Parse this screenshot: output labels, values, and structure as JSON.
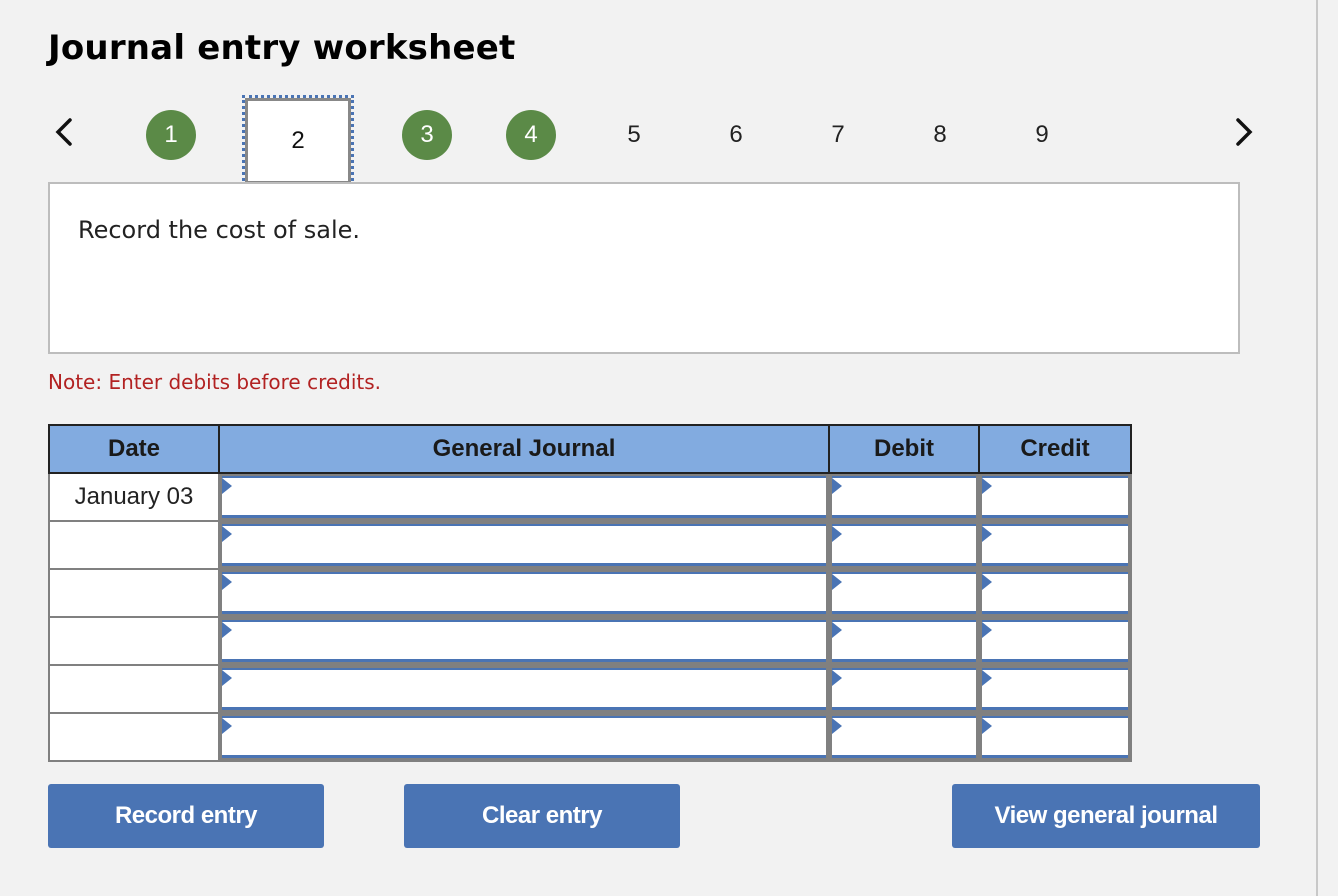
{
  "title": "Journal entry worksheet",
  "nav": {
    "prev_icon": "chevron-left-icon",
    "next_icon": "chevron-right-icon",
    "steps": [
      {
        "label": "1",
        "state": "done"
      },
      {
        "label": "2",
        "state": "current"
      },
      {
        "label": "3",
        "state": "done"
      },
      {
        "label": "4",
        "state": "done"
      },
      {
        "label": "5",
        "state": "plain"
      },
      {
        "label": "6",
        "state": "plain"
      },
      {
        "label": "7",
        "state": "plain"
      },
      {
        "label": "8",
        "state": "plain"
      },
      {
        "label": "9",
        "state": "plain"
      }
    ]
  },
  "prompt": "Record the cost of sale.",
  "note": "Note: Enter debits before credits.",
  "table": {
    "headers": [
      "Date",
      "General Journal",
      "Debit",
      "Credit"
    ],
    "rows": [
      {
        "date": "January 03",
        "account": "",
        "debit": "",
        "credit": ""
      },
      {
        "date": "",
        "account": "",
        "debit": "",
        "credit": ""
      },
      {
        "date": "",
        "account": "",
        "debit": "",
        "credit": ""
      },
      {
        "date": "",
        "account": "",
        "debit": "",
        "credit": ""
      },
      {
        "date": "",
        "account": "",
        "debit": "",
        "credit": ""
      },
      {
        "date": "",
        "account": "",
        "debit": "",
        "credit": ""
      }
    ]
  },
  "buttons": {
    "record": "Record entry",
    "clear": "Clear entry",
    "view": "View general journal"
  },
  "colors": {
    "accent": "#4a74b4",
    "done_step": "#5b8a47",
    "header_bg": "#82abe0",
    "note": "#b22222"
  }
}
